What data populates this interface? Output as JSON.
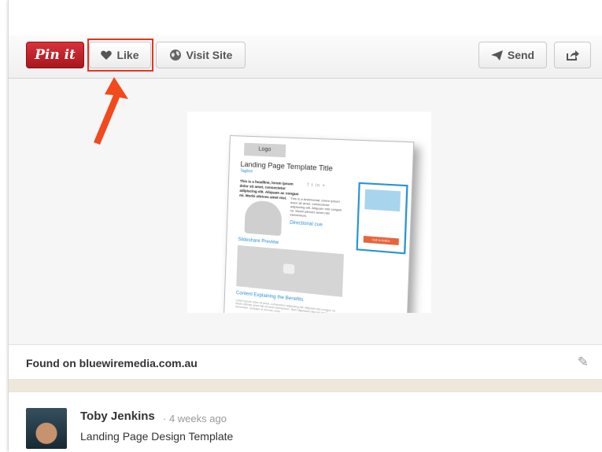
{
  "toolbar": {
    "pin_label": "Pin it",
    "like_label": "Like",
    "visit_label": "Visit Site",
    "send_label": "Send"
  },
  "pin_image": {
    "logo": "Logo",
    "title": "Landing Page Template Title",
    "tagline": "Tagline",
    "headline": "This is a headline, lorem ipsum dolor sit amet, consectetur adipiscing elit. Aliquam ac congue mi. Morbi ultrices amet nisi.",
    "social": "f t in +",
    "quote": "This is a testimonial, lorem ipsum dolor sit amet, consectetur adipiscing elit. Aliquam nisl congue mi. Morbi ultrices amet nisi elementum.",
    "cue": "Directional cue",
    "form_button": "Call to Action",
    "slideshare": "Slideshare Preview",
    "benefits": "Content Explaining the Benefits",
    "lines": "Lorem ipsum dolor sit amet, consectetur adipiscing elit. Aliquam nisl congue mi. Morbi ultrices amet nisi sit amet elementum. Nam dignissim nisi nec tempor accumsan. Quisque et nisl nec urna."
  },
  "source": {
    "found_text": "Found on bluewiremedia.com.au"
  },
  "pinner": {
    "name": "Toby Jenkins",
    "time": "· 4 weeks ago",
    "board": "Landing Page Design Template"
  },
  "colors": {
    "pin_red": "#c0202a",
    "highlight": "#e8331d",
    "accent_blue": "#2a93d5"
  }
}
